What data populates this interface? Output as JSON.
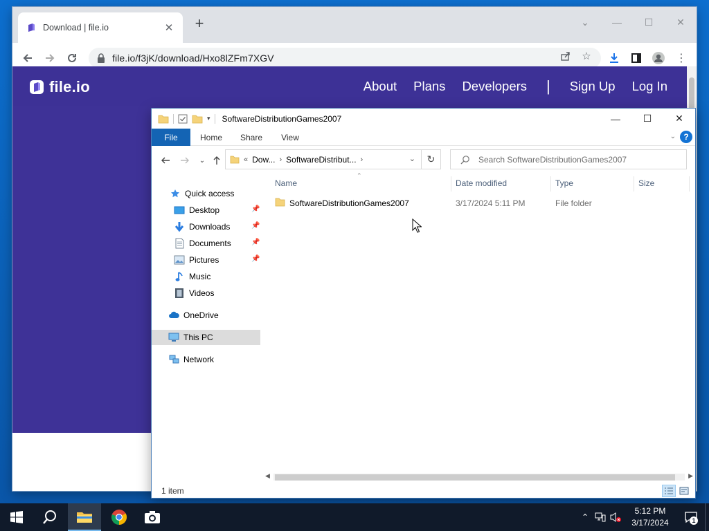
{
  "browser": {
    "tab_title": "Download | file.io",
    "url": "file.io/f3jK/download/Hxo8lZFm7XGV"
  },
  "site": {
    "logo_text": "file.io",
    "nav": [
      "About",
      "Plans",
      "Developers",
      "|",
      "Sign Up",
      "Log In"
    ],
    "header_color": "#3d3196"
  },
  "explorer": {
    "title": "SoftwareDistributionGames2007",
    "ribbon_tabs": [
      "File",
      "Home",
      "Share",
      "View"
    ],
    "breadcrumb": [
      "Dow...",
      "SoftwareDistribut..."
    ],
    "search_placeholder": "Search SoftwareDistributionGames2007",
    "nav": {
      "quick_access": "Quick access",
      "desktop": "Desktop",
      "downloads": "Downloads",
      "documents": "Documents",
      "pictures": "Pictures",
      "music": "Music",
      "videos": "Videos",
      "onedrive": "OneDrive",
      "this_pc": "This PC",
      "network": "Network"
    },
    "columns": [
      "Name",
      "Date modified",
      "Type",
      "Size"
    ],
    "rows": [
      {
        "name": "SoftwareDistributionGames2007",
        "date": "3/17/2024 5:11 PM",
        "type": "File folder",
        "size": ""
      }
    ],
    "status": "1 item"
  },
  "taskbar": {
    "time": "5:12 PM",
    "date": "3/17/2024",
    "notification_count": "1"
  }
}
